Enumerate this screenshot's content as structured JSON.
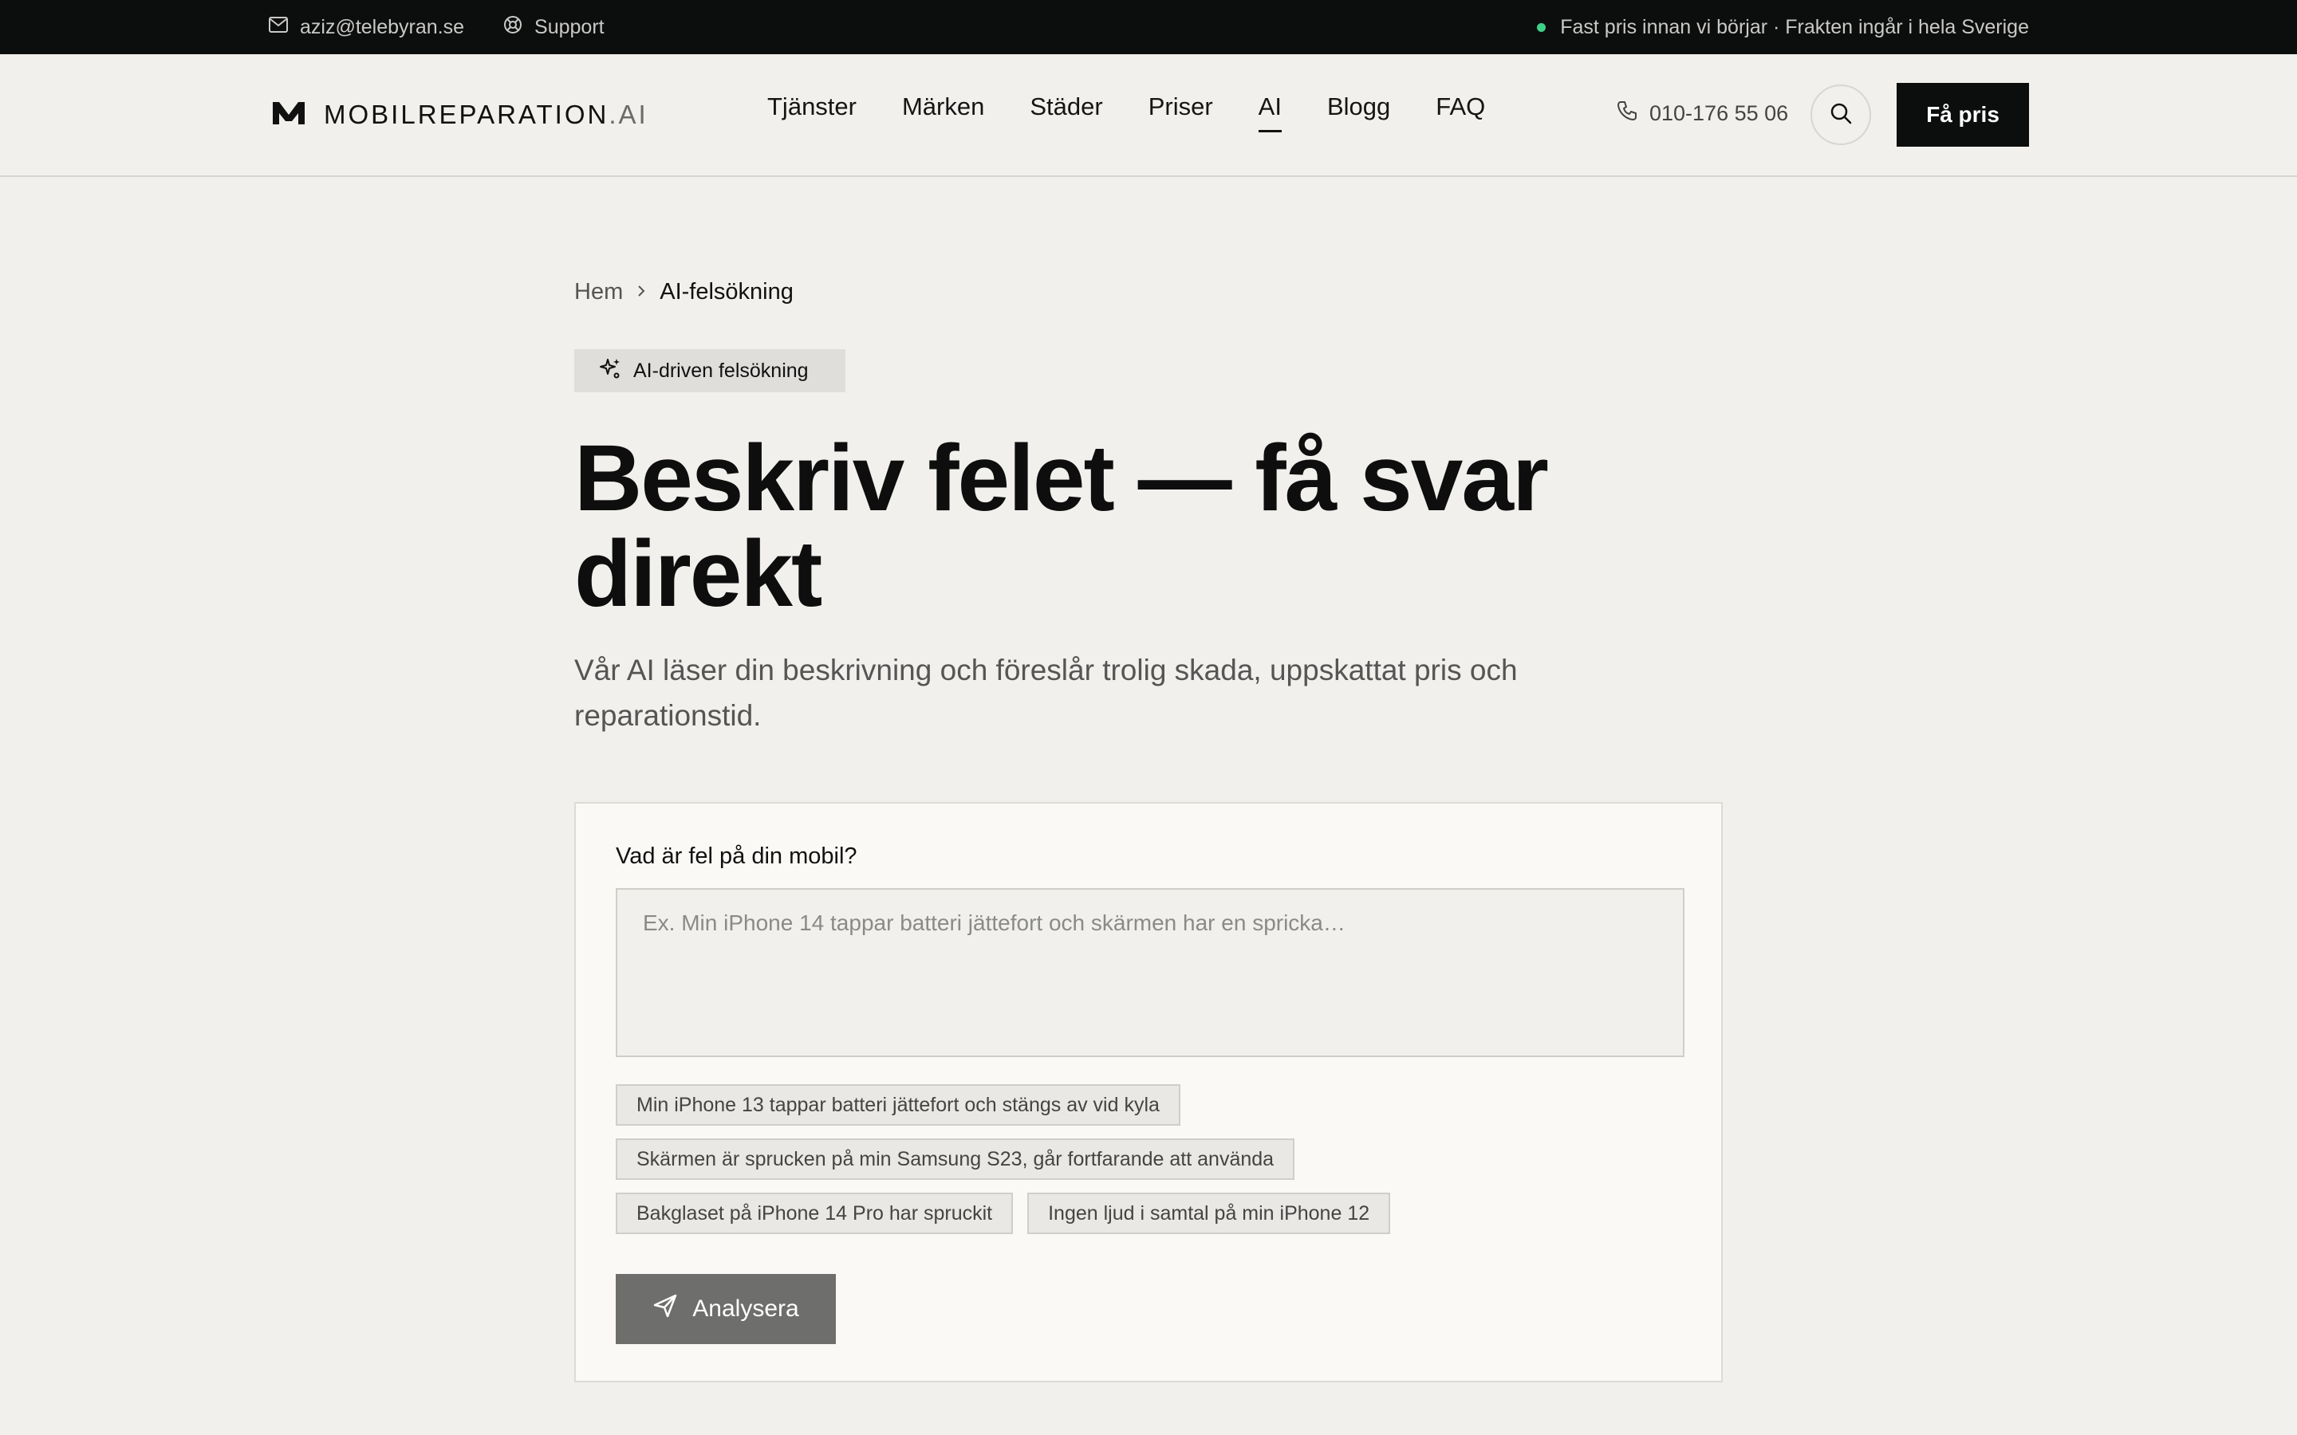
{
  "topbar": {
    "email": "aziz@telebyran.se",
    "support": "Support",
    "notice": "Fast pris innan vi börjar · Frakten ingår i hela Sverige",
    "status_color": "#3fd08a"
  },
  "header": {
    "logo_main": "MOBILREPARATION",
    "logo_suffix": ".AI",
    "nav": [
      {
        "label": "Tjänster"
      },
      {
        "label": "Märken"
      },
      {
        "label": "Städer"
      },
      {
        "label": "Priser"
      },
      {
        "label": "AI",
        "active": true
      },
      {
        "label": "Blogg"
      },
      {
        "label": "FAQ"
      }
    ],
    "phone": "010-176 55 06",
    "cta": "Få pris"
  },
  "breadcrumb": {
    "home": "Hem",
    "current": "AI-felsökning"
  },
  "badge": "AI-driven felsökning",
  "hero": {
    "title": "Beskriv felet — få svar direkt",
    "subtitle": "Vår AI läser din beskrivning och föreslår trolig skada, uppskattat pris och reparationstid."
  },
  "form": {
    "label": "Vad är fel på din mobil?",
    "placeholder": "Ex. Min iPhone 14 tappar batteri jättefort och skärmen har en spricka…",
    "value": "",
    "suggestions": [
      "Min iPhone 13 tappar batteri jättefort och stängs av vid kyla",
      "Skärmen är sprucken på min Samsung S23, går fortfarande att använda",
      "Bakglaset på iPhone 14 Pro har spruckit",
      "Ingen ljud i samtal på min iPhone 12"
    ],
    "submit": "Analysera"
  },
  "colors": {
    "background": "#f1f0ec",
    "dark": "#0c0d0d",
    "button_disabled": "#6e6e6d"
  }
}
